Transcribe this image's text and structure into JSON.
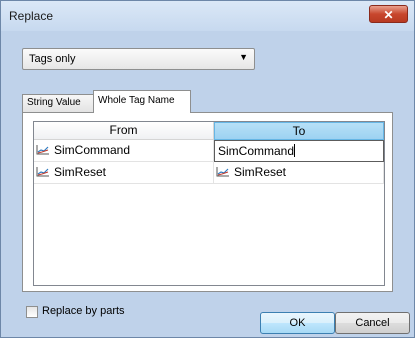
{
  "window": {
    "title": "Replace"
  },
  "scope_dropdown": {
    "selected": "Tags only"
  },
  "tabs": [
    {
      "label": "String Value",
      "active": false
    },
    {
      "label": "Whole Tag Name",
      "active": true
    }
  ],
  "grid": {
    "headers": {
      "from": "From",
      "to": "To"
    },
    "rows": [
      {
        "from": "SimCommand",
        "to": "SimCommand",
        "editing": true
      },
      {
        "from": "SimReset",
        "to": "SimReset",
        "editing": false
      }
    ]
  },
  "replace_by_parts": {
    "label": "Replace by parts",
    "checked": false
  },
  "buttons": {
    "ok": "OK",
    "cancel": "Cancel"
  },
  "close_glyph": "✕"
}
